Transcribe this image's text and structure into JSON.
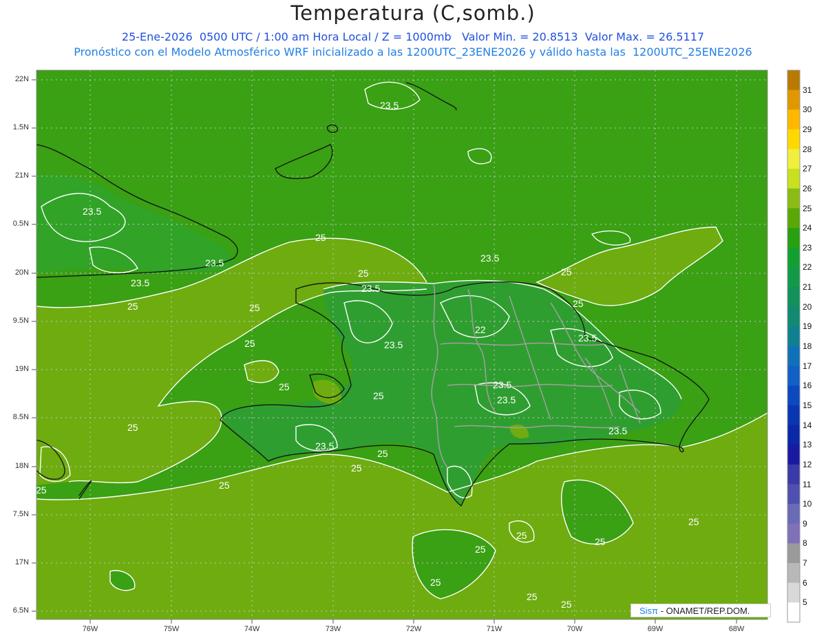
{
  "header": {
    "title": "Temperatura (C,somb.)",
    "subtitle_line1": "25-Ene-2026  0500 UTC / 1:00 am Hora Local / Z = 1000mb   Valor Min. = 20.8513  Valor Max. = 26.5117",
    "subtitle_line2": "Pronóstico con el Modelo Atmosférico WRF inicializado a las 1200UTC_23ENE2026 y válido hasta las  1200UTC_25ENE2026"
  },
  "axes": {
    "lat_labels": [
      "22N",
      "1.5N",
      "21N",
      "0.5N",
      "20N",
      "9.5N",
      "19N",
      "8.5N",
      "18N",
      "7.5N",
      "17N",
      "6.5N"
    ],
    "lon_labels": [
      "76W",
      "75W",
      "74W",
      "73W",
      "72W",
      "71W",
      "70W",
      "69W",
      "68W"
    ]
  },
  "colorbar": {
    "labels": [
      "31",
      "30",
      "29",
      "28",
      "27",
      "26",
      "25",
      "24",
      "23",
      "22",
      "21",
      "20",
      "19",
      "18",
      "17",
      "16",
      "15",
      "14",
      "13",
      "12",
      "11",
      "10",
      "9",
      "8",
      "7",
      "6",
      "5"
    ],
    "colors": [
      "#b87a00",
      "#e09800",
      "#ffb800",
      "#ffd800",
      "#f0ef40",
      "#c8e020",
      "#8cbc14",
      "#5aa808",
      "#28a010",
      "#14a030",
      "#129a48",
      "#10925a",
      "#108a70",
      "#0f8090",
      "#1070b8",
      "#1060c8",
      "#0c48c0",
      "#0a36b4",
      "#0a28a8",
      "#1a1aa0",
      "#3a3aa8",
      "#5050b0",
      "#6a6ab8",
      "#8070b8",
      "#9a9a9a",
      "#b8b8b8",
      "#d8d8d8",
      "#ffffff"
    ]
  },
  "map": {
    "legend_low": "#3aa014",
    "legend_high": "#6eac10",
    "contour_labels": [
      {
        "text": "23.5"
      },
      {
        "text": "23.5"
      },
      {
        "text": "23.5"
      },
      {
        "text": "23.5"
      },
      {
        "text": "25"
      },
      {
        "text": "25"
      },
      {
        "text": "25"
      },
      {
        "text": "23.5"
      },
      {
        "text": "23.5"
      },
      {
        "text": "25"
      },
      {
        "text": "25"
      },
      {
        "text": "23.5"
      },
      {
        "text": "22"
      },
      {
        "text": "25"
      },
      {
        "text": "23.5"
      },
      {
        "text": "25"
      },
      {
        "text": "25"
      },
      {
        "text": "23.5"
      },
      {
        "text": "23.5"
      },
      {
        "text": "23.5"
      },
      {
        "text": "25"
      },
      {
        "text": "23.5"
      },
      {
        "text": "25"
      },
      {
        "text": "25"
      },
      {
        "text": "25"
      },
      {
        "text": "25"
      },
      {
        "text": "25"
      },
      {
        "text": "25"
      },
      {
        "text": "25"
      },
      {
        "text": "25"
      },
      {
        "text": "25"
      },
      {
        "text": "25"
      },
      {
        "text": "25"
      },
      {
        "text": "25"
      }
    ]
  },
  "credit": {
    "brand": "Sisπ",
    "text": " - ONAMET/REP.DOM."
  }
}
